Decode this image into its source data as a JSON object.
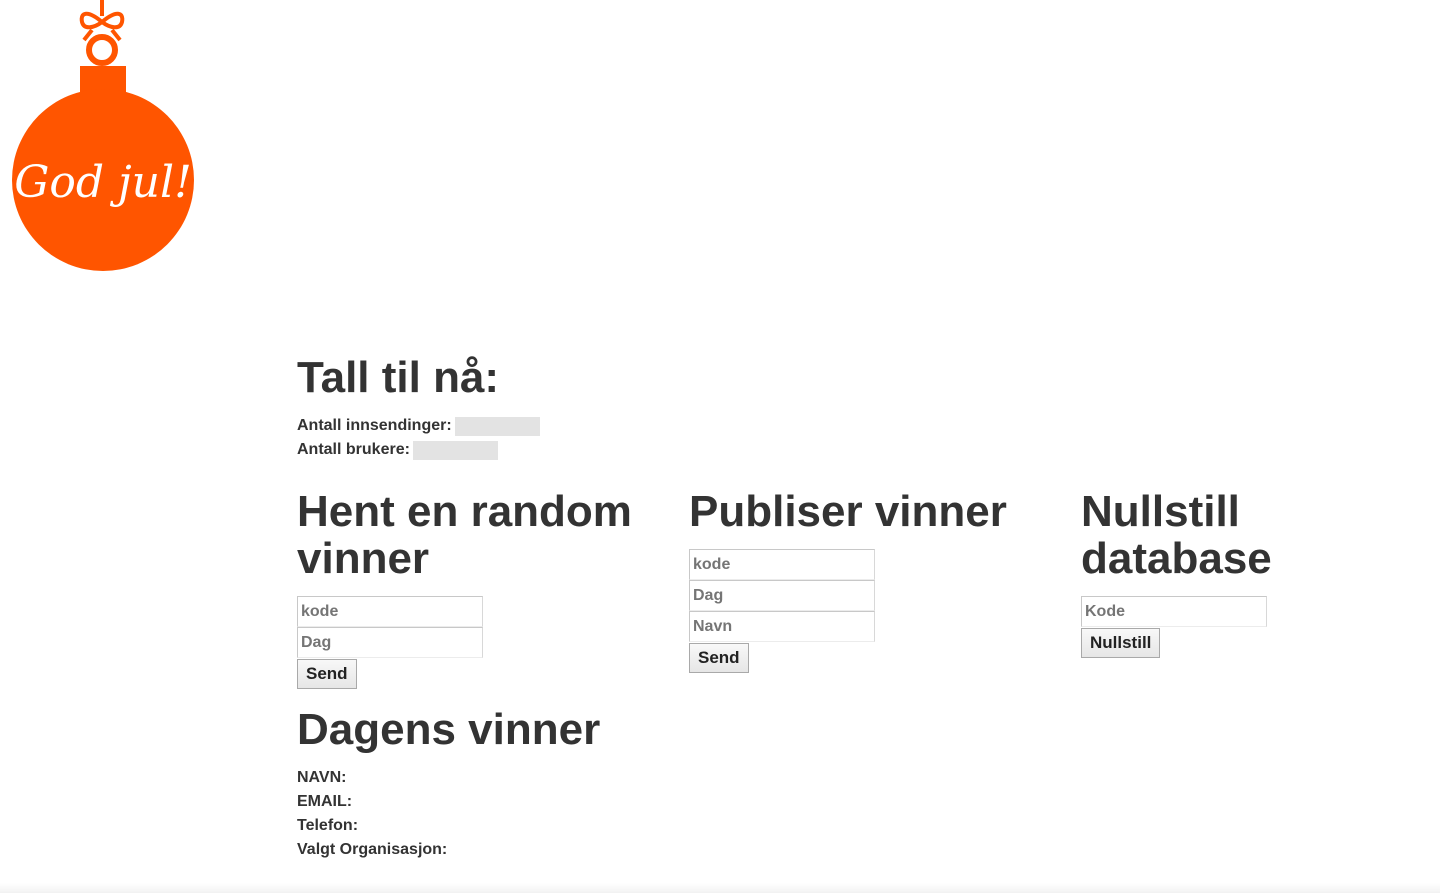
{
  "logo": {
    "text": "God jul!",
    "color": "#ff5500"
  },
  "stats": {
    "title": "Tall til nå:",
    "submissions_label": "Antall innsendinger:",
    "users_label": "Antall brukere:"
  },
  "random_winner": {
    "title": "Hent en random vinner",
    "code_placeholder": "kode",
    "day_placeholder": "Dag",
    "send_label": "Send"
  },
  "publish_winner": {
    "title": "Publiser vinner",
    "code_placeholder": "kode",
    "day_placeholder": "Dag",
    "name_placeholder": "Navn",
    "send_label": "Send"
  },
  "reset_db": {
    "title": "Nullstill database",
    "code_placeholder": "Kode",
    "reset_label": "Nullstill"
  },
  "todays_winner": {
    "title": "Dagens vinner",
    "name_label": "NAVN:",
    "email_label": "EMAIL:",
    "phone_label": "Telefon:",
    "org_label": "Valgt Organisasjon:"
  }
}
